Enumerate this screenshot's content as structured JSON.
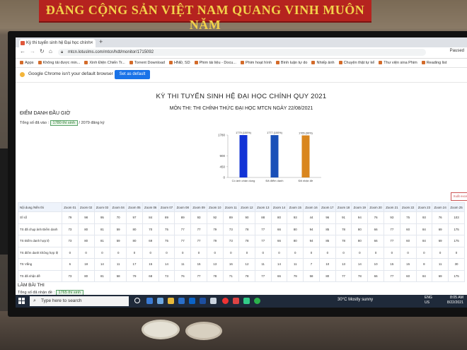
{
  "environment": {
    "banner_text": "ĐẢNG CỘNG SẢN VIỆT NAM QUANG VINH MUÔN NĂM"
  },
  "browser": {
    "tab_title": "Kỳ thi tuyển sinh hệ Đại học chính",
    "url": "mtcn.lotuslms.com/mtcn/hdt/monitor/1715092",
    "profile_label": "Paused",
    "bookmarks": [
      "Apps",
      "Không tải được min...",
      "Xinh Điện Chiến Tr...",
      "Torrent Download",
      "HNĐ, SD",
      "Phim tài liệu - Docu...",
      "Phim hoạt hình",
      "Bình luận tự do",
      "Nhiếp ảnh",
      "Chuyện thật tự kể",
      "Thư viện sina Phim",
      "Reading list"
    ],
    "infobar_text": "Google Chrome isn't your default browser",
    "infobar_button": "Set as default"
  },
  "page": {
    "title": "KỲ THI TUYỂN SINH HỆ ĐẠI HỌC CHÍNH QUY 2021",
    "subtitle": "MÔN THI: THI CHÍNH THỨC ĐẠI HỌC MTCN NGÀY 22/08/2021",
    "section1": "ĐIỂM DANH ĐẦU GIỜ",
    "stat1_prefix": "Tổng số đã vào :",
    "stat1_value": "1780 thí sinh",
    "stat1_suffix": "/ 2079 đăng ký",
    "side_button": "Xuất exce",
    "section2": "LÀM BÀI THI",
    "stat2_prefix": "Tổng số đã nhận đề :",
    "stat2_value": "1765 thí sinh"
  },
  "chart_data": {
    "type": "bar",
    "categories": [
      "Có ảnh chân dung",
      "Đã điểm danh",
      "Đã nhận đề"
    ],
    "values": [
      1779,
      1777,
      1765
    ],
    "value_labels": [
      "1779 (100%)",
      "1777 (100%)",
      "1765 (99%)"
    ],
    "colors": [
      "#1233d6",
      "#1a50b8",
      "#d9861e"
    ],
    "yticks": [
      0,
      450,
      900,
      1780
    ],
    "ylim": [
      0,
      1780
    ]
  },
  "table": {
    "row_header": "Nội dung /Nền thi",
    "columns": [
      "Zoom 01",
      "Zoom 02",
      "Zoom 03",
      "Zoom 04",
      "Zoom 05",
      "Zoom 06",
      "Zoom 07",
      "Zoom 08",
      "Zoom 09",
      "Zoom 10",
      "Zoom 11",
      "Zoom 12",
      "Zoom 13",
      "Zoom 14",
      "Zoom 15",
      "Zoom 16",
      "Zoom 17",
      "Zoom 18",
      "Zoom 19",
      "Zoom 20",
      "Zoom 21",
      "Zoom 22",
      "Zoom 23",
      "Zoom 24",
      "Zoom 25"
    ],
    "rows": [
      {
        "label": "Sĩ số",
        "cells": [
          "79",
          "98",
          "95",
          "70",
          "97",
          "84",
          "89",
          "89",
          "93",
          "92",
          "89",
          "90",
          "88",
          "80",
          "93",
          "44",
          "96",
          "91",
          "94",
          "76",
          "93",
          "75",
          "93",
          "76",
          "103"
        ]
      },
      {
        "label": "TS đã chụp ảnh Điểm danh",
        "cells": [
          "73",
          "80",
          "81",
          "59",
          "80",
          "70",
          "75",
          "77",
          "77",
          "79",
          "73",
          "78",
          "77",
          "66",
          "80",
          "94",
          "85",
          "78",
          "80",
          "66",
          "77",
          "60",
          "84",
          "69",
          "175"
        ]
      },
      {
        "label": "TS Điểm danh hợp lệ",
        "cells": [
          "73",
          "80",
          "81",
          "59",
          "80",
          "69",
          "75",
          "77",
          "77",
          "79",
          "73",
          "78",
          "77",
          "66",
          "80",
          "94",
          "85",
          "78",
          "80",
          "66",
          "77",
          "60",
          "84",
          "69",
          "175"
        ]
      },
      {
        "label": "TS điểm danh không hợp lệ",
        "cells": [
          "0",
          "0",
          "0",
          "0",
          "0",
          "0",
          "0",
          "0",
          "0",
          "0",
          "0",
          "0",
          "0",
          "0",
          "0",
          "0",
          "0",
          "0",
          "0",
          "0",
          "0",
          "0",
          "0",
          "0",
          "0"
        ]
      },
      {
        "label": "TS Vắng",
        "cells": [
          "6",
          "18",
          "14",
          "11",
          "17",
          "15",
          "14",
          "11",
          "15",
          "13",
          "16",
          "12",
          "11",
          "14",
          "11",
          "7",
          "10",
          "13",
          "14",
          "10",
          "15",
          "15",
          "8",
          "11",
          "30"
        ]
      },
      {
        "label": "TS đã nhận đề",
        "cells": [
          "73",
          "80",
          "81",
          "58",
          "79",
          "68",
          "73",
          "76",
          "77",
          "78",
          "71",
          "78",
          "77",
          "66",
          "79",
          "58",
          "80",
          "77",
          "78",
          "66",
          "77",
          "60",
          "84",
          "69",
          "175"
        ]
      }
    ]
  },
  "taskbar": {
    "search_placeholder": "Type here to search",
    "weather": "30°C  Mostly sunny",
    "lang": "ENG",
    "lang2": "US",
    "time": "8:05 AM",
    "date": "8/22/2021"
  }
}
